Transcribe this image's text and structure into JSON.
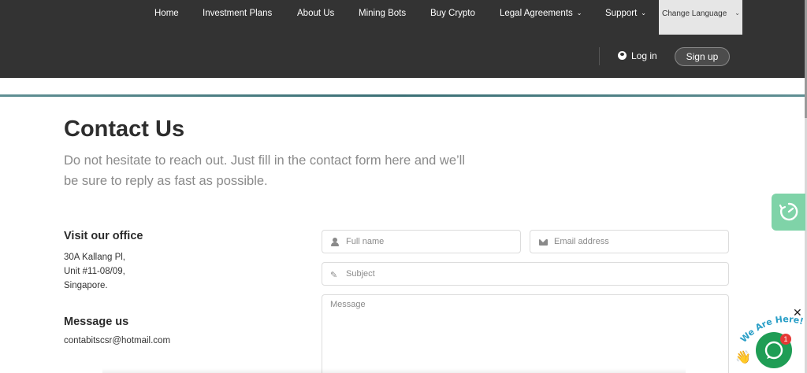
{
  "nav": {
    "items": [
      {
        "label": "Home",
        "dropdown": false
      },
      {
        "label": "Investment Plans",
        "dropdown": false
      },
      {
        "label": "About Us",
        "dropdown": false
      },
      {
        "label": "Mining Bots",
        "dropdown": false
      },
      {
        "label": "Buy Crypto",
        "dropdown": false
      },
      {
        "label": "Legal Agreements",
        "dropdown": true
      },
      {
        "label": "Support",
        "dropdown": true
      }
    ],
    "language_label": "Change Language",
    "login_label": "Log in",
    "signup_label": "Sign up"
  },
  "page": {
    "title": "Contact Us",
    "subtitle": "Do not hesitate to reach out. Just fill in the contact form here and we’ll be sure to reply as fast as possible."
  },
  "office": {
    "heading": "Visit our office",
    "address_lines": [
      "30A Kallang Pl,",
      "Unit #11-08/09,",
      "Singapore."
    ]
  },
  "message": {
    "heading": "Message us",
    "email": "contabitscsr@hotmail.com"
  },
  "form": {
    "fullname_placeholder": "Full name",
    "email_placeholder": "Email address",
    "subject_placeholder": "Subject",
    "message_placeholder": "Message"
  },
  "widgets": {
    "chat_badge_count": "1",
    "chat_banner": "We Are Here!",
    "close_glyph": "✕"
  },
  "colors": {
    "header_bg": "#333333",
    "accent_line": "#3b6f75",
    "side_widget": "#7fd3a8",
    "chat_button": "#1f9d55",
    "badge": "#e53935"
  },
  "icons": [
    "user-icon",
    "envelope-icon",
    "pencil-icon",
    "chevron-down-icon",
    "gauge-icon",
    "chat-icon",
    "close-icon",
    "wave-hand-icon"
  ]
}
